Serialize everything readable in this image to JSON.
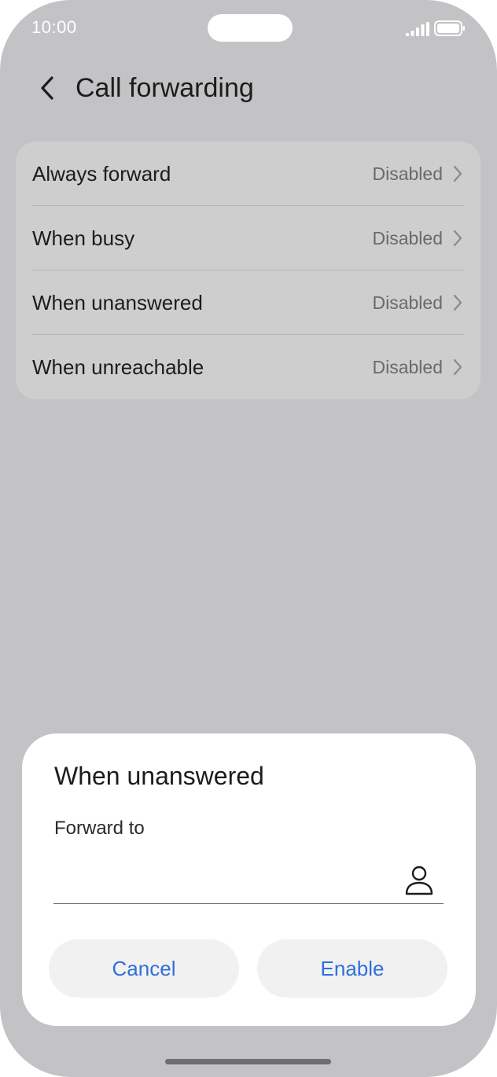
{
  "status_bar": {
    "time": "10:00",
    "signal_icon": "signal-icon",
    "battery_icon": "battery-icon"
  },
  "header": {
    "title": "Call forwarding",
    "back_icon": "back-arrow-icon"
  },
  "forwarding_options": [
    {
      "label": "Always forward",
      "value": "Disabled"
    },
    {
      "label": "When busy",
      "value": "Disabled"
    },
    {
      "label": "When unanswered",
      "value": "Disabled"
    },
    {
      "label": "When unreachable",
      "value": "Disabled"
    }
  ],
  "dialog": {
    "title": "When unanswered",
    "field_label": "Forward to",
    "field_value": "",
    "contact_icon": "contact-person-icon",
    "cancel_label": "Cancel",
    "enable_label": "Enable"
  },
  "colors": {
    "background": "#c3c3c6",
    "card": "#cececf",
    "accent": "#2f6fd6",
    "dialog": "#ffffff"
  }
}
